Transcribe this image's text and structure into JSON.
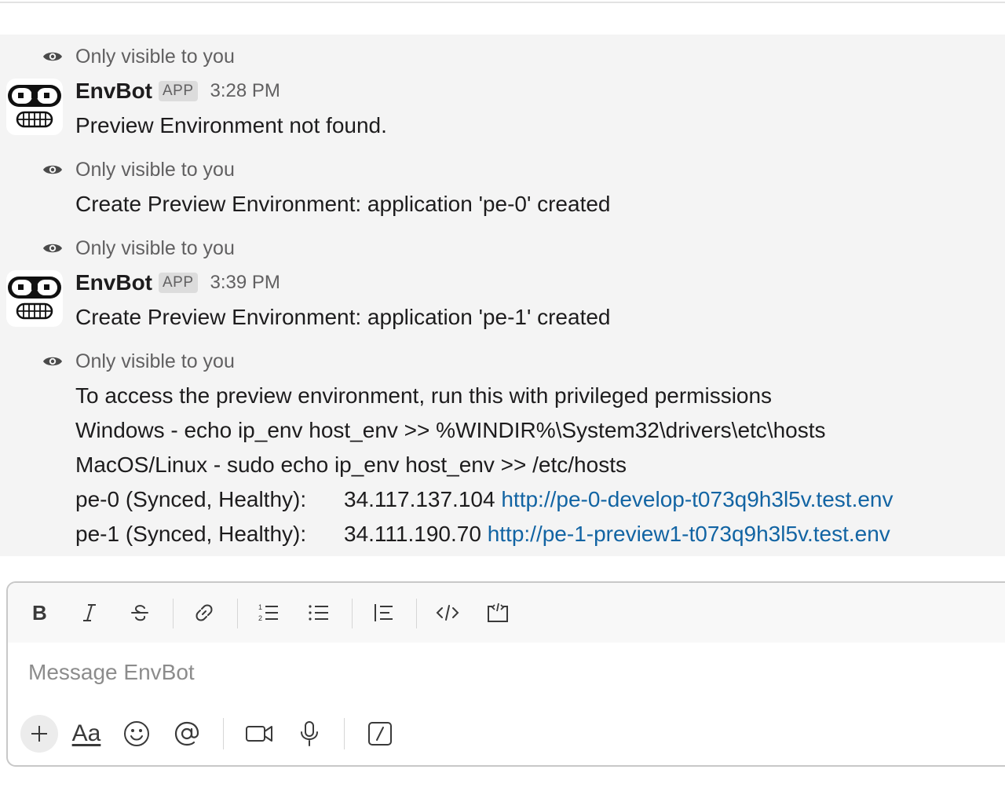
{
  "feed": {
    "visibility_note": "Only visible to you",
    "messages": [
      {
        "sender": "EnvBot",
        "badge": "APP",
        "time": "3:28 PM",
        "text": "Preview Environment not found."
      },
      {
        "text": "Create Preview Environment: application 'pe-0' created"
      },
      {
        "sender": "EnvBot",
        "badge": "APP",
        "time": "3:39 PM",
        "text": "Create Preview Environment: application 'pe-1' created"
      },
      {
        "lines": [
          "To access the preview environment, run this with privileged permissions",
          "Windows - echo ip_env host_env >> %WINDIR%\\System32\\drivers\\etc\\hosts",
          "MacOS/Linux - sudo echo ip_env host_env >> /etc/hosts"
        ],
        "envs": [
          {
            "label": "pe-0 (Synced, Healthy):",
            "ip": "34.117.137.104",
            "url": "http://pe-0-develop-t073q9h3l5v.test.env"
          },
          {
            "label": "pe-1 (Synced, Healthy):",
            "ip": "34.111.190.70",
            "url": "http://pe-1-preview1-t073q9h3l5v.test.env"
          }
        ]
      }
    ]
  },
  "composer": {
    "placeholder": "Message EnvBot",
    "format_tools": [
      "bold-icon",
      "italic-icon",
      "strikethrough-icon",
      "link-icon",
      "ordered-list-icon",
      "bulleted-list-icon",
      "blockquote-icon",
      "code-icon",
      "code-block-icon"
    ],
    "action_tools": [
      "plus-icon",
      "formatting-icon",
      "emoji-icon",
      "mention-icon",
      "video-icon",
      "microphone-icon",
      "slash-command-icon"
    ],
    "formatting_label": "Aa"
  },
  "colors": {
    "link": "#1264a3",
    "feed_background": "#f4f4f4",
    "muted_text": "#616061"
  }
}
